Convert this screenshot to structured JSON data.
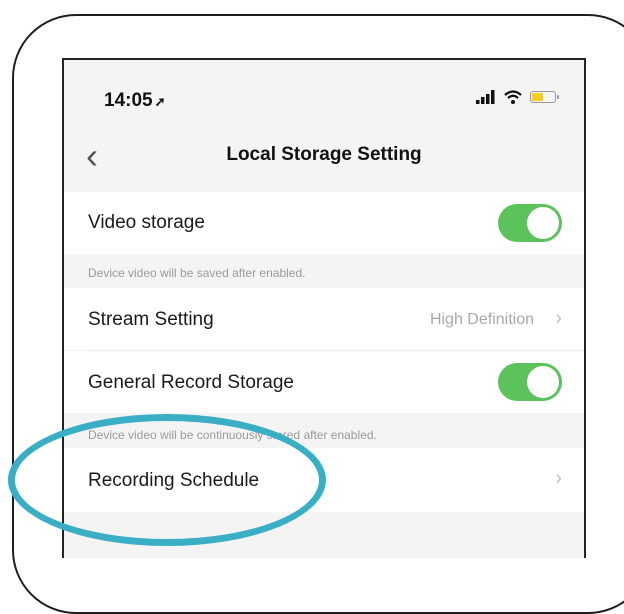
{
  "status_bar": {
    "time": "14:05",
    "location_glyph": "➚",
    "battery_color": "#f5cd1e"
  },
  "nav": {
    "back_glyph": "‹",
    "title": "Local Storage Setting"
  },
  "settings": {
    "video_storage": {
      "label": "Video storage",
      "enabled": true,
      "hint": "Device video will be saved after enabled."
    },
    "stream_setting": {
      "label": "Stream Setting",
      "value": "High Definition",
      "chevron": "›"
    },
    "general_record_storage": {
      "label": "General Record Storage",
      "enabled": true,
      "hint": "Device video will be continuously stored after enabled."
    },
    "recording_schedule": {
      "label": "Recording Schedule",
      "chevron": "›"
    }
  },
  "colors": {
    "toggle_on": "#5cc25c",
    "highlight_ring": "#3aaec4"
  }
}
